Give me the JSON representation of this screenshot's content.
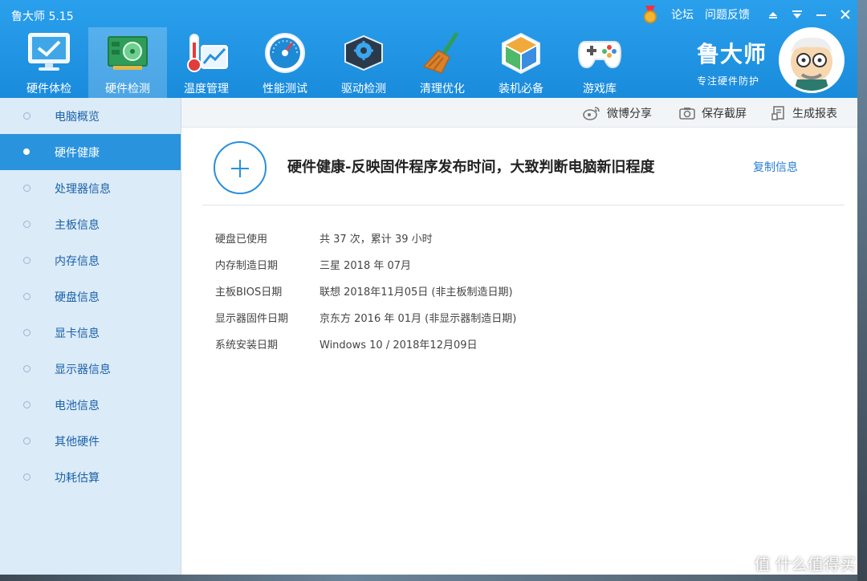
{
  "window": {
    "title": "鲁大师 5.15",
    "links": [
      "论坛",
      "问题反馈"
    ]
  },
  "toolbar": {
    "items": [
      {
        "label": "硬件体检",
        "icon": "monitor-check-icon"
      },
      {
        "label": "硬件检测",
        "icon": "hardware-board-icon",
        "active": true
      },
      {
        "label": "温度管理",
        "icon": "thermometer-icon"
      },
      {
        "label": "性能测试",
        "icon": "speedometer-icon"
      },
      {
        "label": "驱动检测",
        "icon": "driver-gear-icon"
      },
      {
        "label": "清理优化",
        "icon": "broom-icon"
      },
      {
        "label": "装机必备",
        "icon": "package-box-icon"
      },
      {
        "label": "游戏库",
        "icon": "gamepad-icon"
      }
    ]
  },
  "brand": {
    "name": "鲁大师",
    "slogan": "专注硬件防护"
  },
  "sidebar": {
    "items": [
      {
        "label": "电脑概览"
      },
      {
        "label": "硬件健康",
        "active": true
      },
      {
        "label": "处理器信息"
      },
      {
        "label": "主板信息"
      },
      {
        "label": "内存信息"
      },
      {
        "label": "硬盘信息"
      },
      {
        "label": "显卡信息"
      },
      {
        "label": "显示器信息"
      },
      {
        "label": "电池信息"
      },
      {
        "label": "其他硬件"
      },
      {
        "label": "功耗估算"
      }
    ]
  },
  "content_toolbar": {
    "share": "微博分享",
    "screenshot": "保存截屏",
    "report": "生成报表"
  },
  "health": {
    "title": "硬件健康-反映固件程序发布时间，大致判断电脑新旧程度",
    "copy_label": "复制信息",
    "rows": [
      {
        "key": "硬盘已使用",
        "value": "共 37 次，累计 39 小时"
      },
      {
        "key": "内存制造日期",
        "value": "三星 2018 年 07月"
      },
      {
        "key": "主板BIOS日期",
        "value": "联想 2018年11月05日 (非主板制造日期)"
      },
      {
        "key": "显示器固件日期",
        "value": "京东方 2016 年 01月 (非显示器制造日期)"
      },
      {
        "key": "系统安装日期",
        "value": "Windows 10 / 2018年12月09日"
      }
    ]
  },
  "watermark": "值 什么值得买",
  "colors": {
    "header": "#1a8bdc",
    "sidebar_bg": "#dcebf8",
    "active_item": "#2a93de",
    "link": "#2a7fd0"
  }
}
